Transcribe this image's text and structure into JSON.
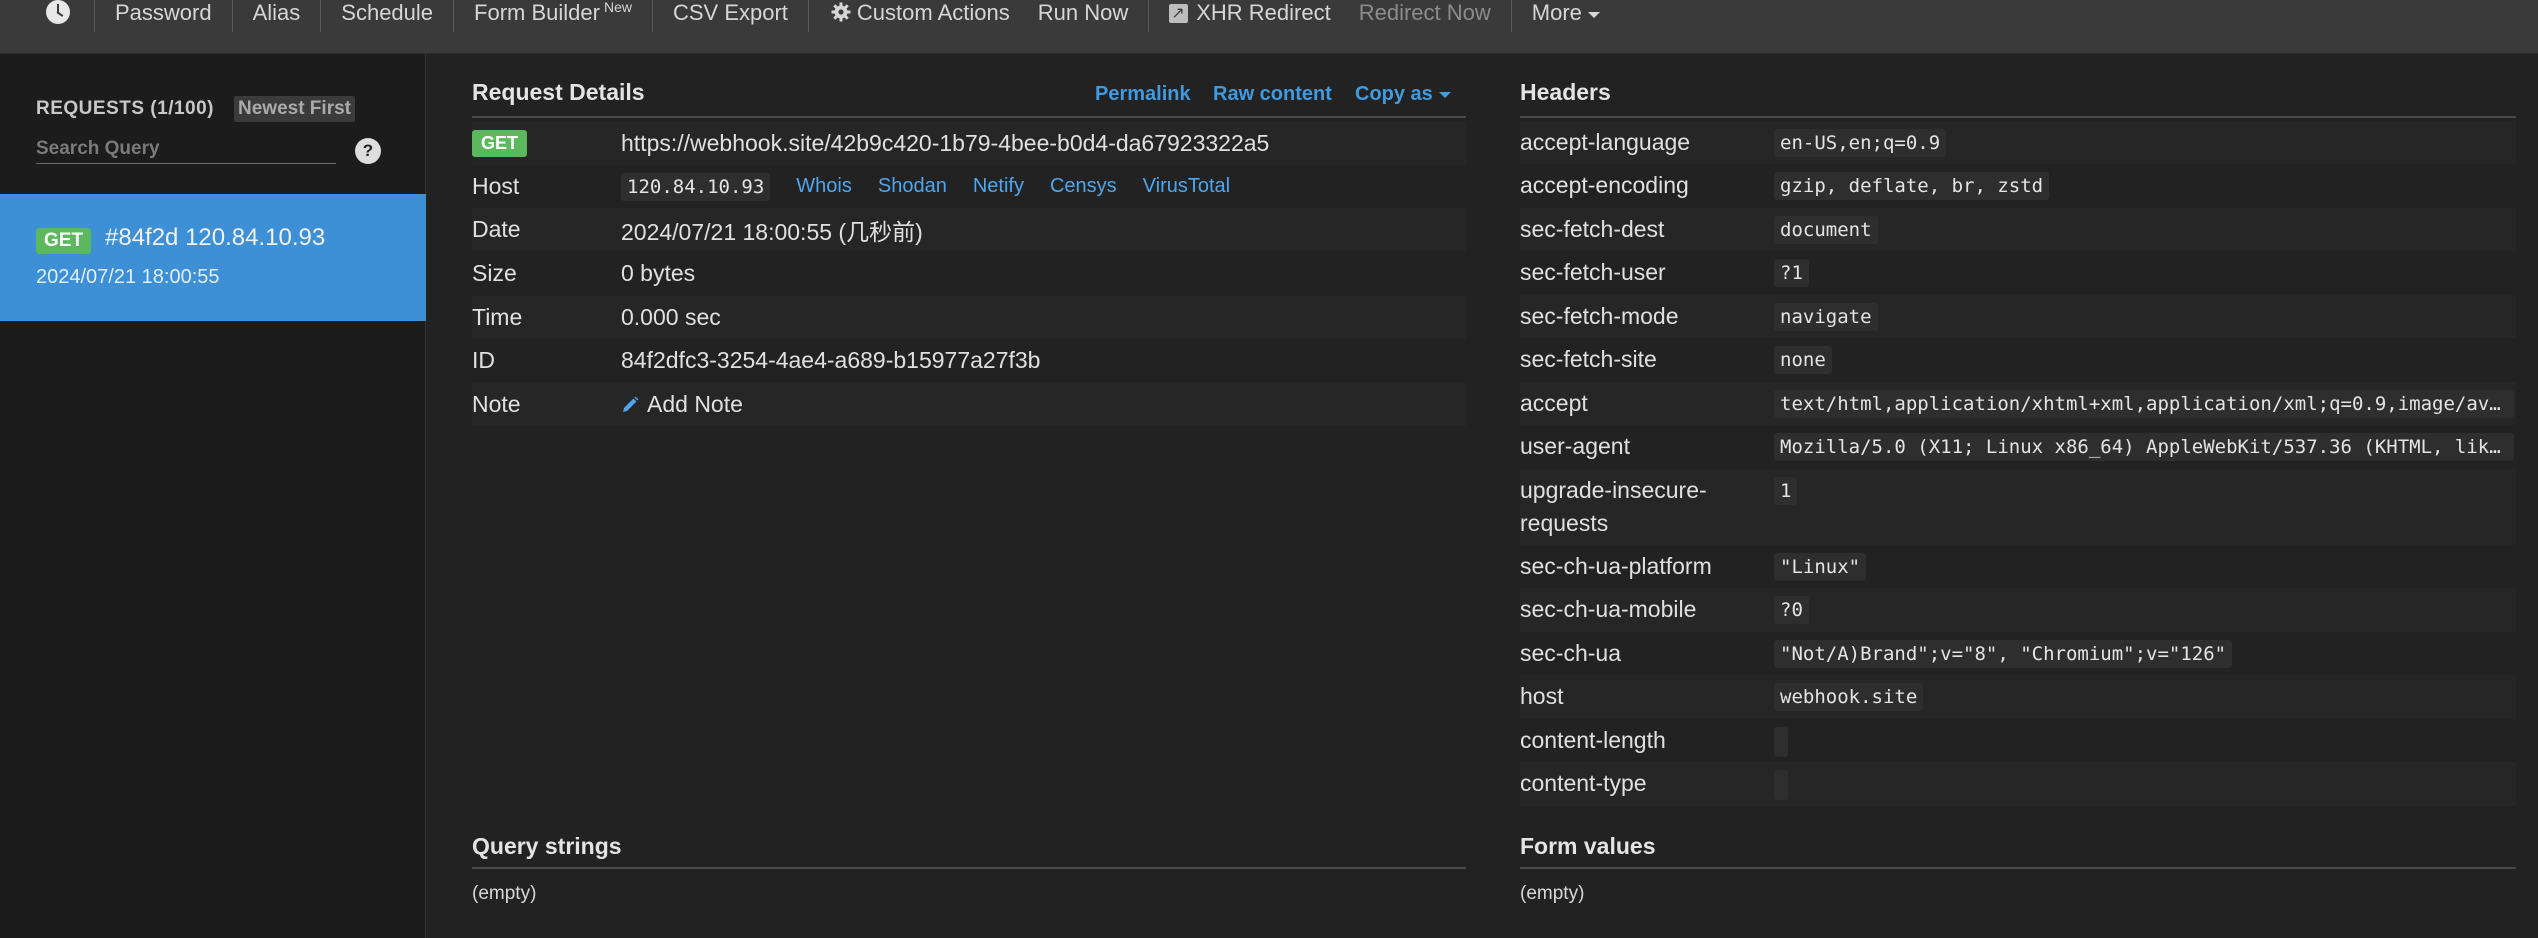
{
  "topbar": {
    "items": [
      {
        "label": "Password"
      },
      {
        "label": "Alias"
      },
      {
        "label": "Schedule"
      },
      {
        "label": "Form Builder",
        "sup": "New"
      },
      {
        "label": "CSV Export"
      },
      {
        "label": "Custom Actions"
      },
      {
        "label": "Run Now"
      },
      {
        "label": "XHR Redirect"
      },
      {
        "label": "Redirect Now"
      },
      {
        "label": "More"
      }
    ]
  },
  "sidebar": {
    "count_label": "REQUESTS (1/100)",
    "sort_label": "Newest First",
    "search_placeholder": "Search Query",
    "help": "?",
    "requests": [
      {
        "method": "GET",
        "title": "#84f2d 120.84.10.93",
        "date": "2024/07/21 18:00:55"
      }
    ]
  },
  "details": {
    "title": "Request Details",
    "permalink": "Permalink",
    "raw": "Raw content",
    "copy_as": "Copy as",
    "method": "GET",
    "url": "https://webhook.site/42b9c420-1b79-4bee-b0d4-da67923322a5",
    "host_label": "Host",
    "host_value": "120.84.10.93",
    "host_links": [
      "Whois",
      "Shodan",
      "Netify",
      "Censys",
      "VirusTotal"
    ],
    "date_label": "Date",
    "date_value": "2024/07/21 18:00:55 (几秒前)",
    "size_label": "Size",
    "size_value": "0 bytes",
    "time_label": "Time",
    "time_value": "0.000 sec",
    "id_label": "ID",
    "id_value": "84f2dfc3-3254-4ae4-a689-b15977a27f3b",
    "note_label": "Note",
    "add_note": "Add Note"
  },
  "headers": {
    "title": "Headers",
    "rows": [
      {
        "key": "accept-language",
        "value": "en-US,en;q=0.9"
      },
      {
        "key": "accept-encoding",
        "value": "gzip, deflate, br, zstd"
      },
      {
        "key": "sec-fetch-dest",
        "value": "document"
      },
      {
        "key": "sec-fetch-user",
        "value": "?1"
      },
      {
        "key": "sec-fetch-mode",
        "value": "navigate"
      },
      {
        "key": "sec-fetch-site",
        "value": "none"
      },
      {
        "key": "accept",
        "value": "text/html,application/xhtml+xml,application/xml;q=0.9,image/av..."
      },
      {
        "key": "user-agent",
        "value": "Mozilla/5.0 (X11; Linux x86_64) AppleWebKit/537.36 (KHTML, lik..."
      },
      {
        "key": "upgrade-insecure-requests",
        "value": "1"
      },
      {
        "key": "sec-ch-ua-platform",
        "value": "\"Linux\""
      },
      {
        "key": "sec-ch-ua-mobile",
        "value": "?0"
      },
      {
        "key": "sec-ch-ua",
        "value": "\"Not/A)Brand\";v=\"8\", \"Chromium\";v=\"126\""
      },
      {
        "key": "host",
        "value": "webhook.site"
      },
      {
        "key": "content-length",
        "value": ""
      },
      {
        "key": "content-type",
        "value": ""
      }
    ]
  },
  "query": {
    "title": "Query strings",
    "empty": "(empty)"
  },
  "form": {
    "title": "Form values",
    "empty": "(empty)"
  }
}
